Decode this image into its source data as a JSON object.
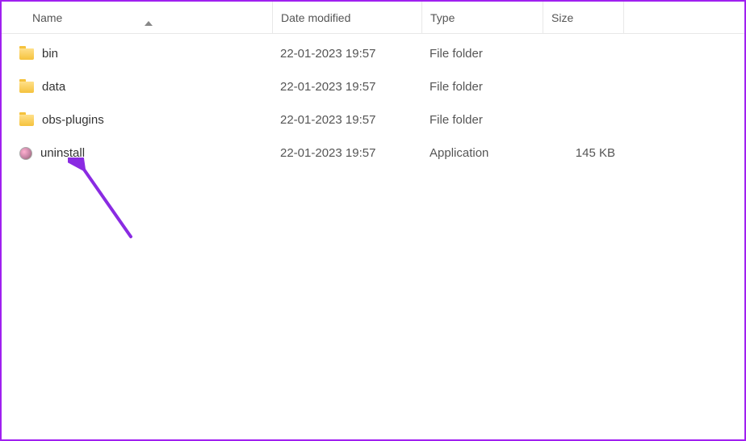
{
  "columns": {
    "name": "Name",
    "date": "Date modified",
    "type": "Type",
    "size": "Size"
  },
  "sortColumn": "name",
  "sortDirection": "asc",
  "items": [
    {
      "name": "bin",
      "date": "22-01-2023 19:57",
      "type": "File folder",
      "size": "",
      "icon": "folder"
    },
    {
      "name": "data",
      "date": "22-01-2023 19:57",
      "type": "File folder",
      "size": "",
      "icon": "folder"
    },
    {
      "name": "obs-plugins",
      "date": "22-01-2023 19:57",
      "type": "File folder",
      "size": "",
      "icon": "folder"
    },
    {
      "name": "uninstall",
      "date": "22-01-2023 19:57",
      "type": "Application",
      "size": "145 KB",
      "icon": "app"
    }
  ],
  "annotation": {
    "targetIndex": 3
  }
}
